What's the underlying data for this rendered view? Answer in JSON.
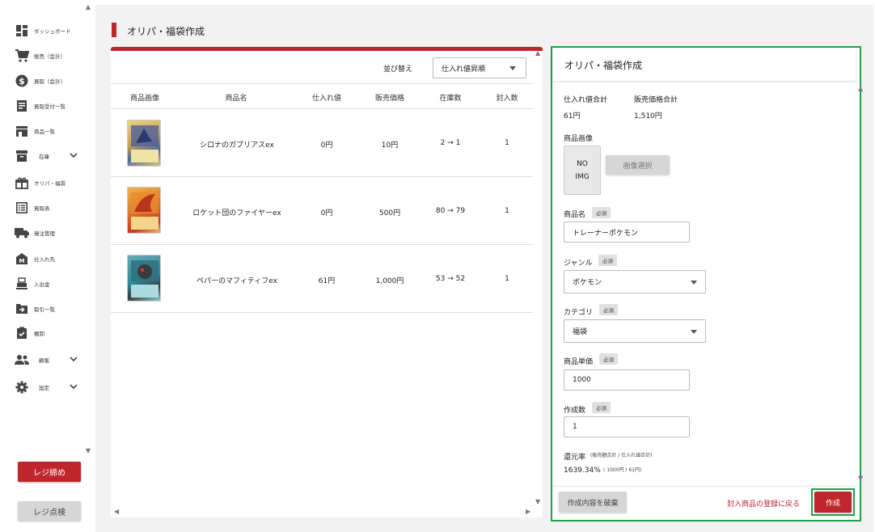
{
  "sidebar": {
    "items": [
      {
        "label": "ダッシュボード",
        "icon": "dashboard-icon"
      },
      {
        "label": "販売（会計）",
        "icon": "cart-icon"
      },
      {
        "label": "買取（会計）",
        "icon": "dollar-icon"
      },
      {
        "label": "買取受付一覧",
        "icon": "receipt-icon"
      },
      {
        "label": "商品一覧",
        "icon": "store-icon"
      },
      {
        "label": "在庫",
        "icon": "archive-icon"
      },
      {
        "label": "オリパ・福袋",
        "icon": "gift-icon"
      },
      {
        "label": "買取表",
        "icon": "list-icon"
      },
      {
        "label": "発注管理",
        "icon": "truck-icon"
      },
      {
        "label": "仕入れ先",
        "icon": "factory-icon"
      },
      {
        "label": "入出金",
        "icon": "register-icon"
      },
      {
        "label": "取引一覧",
        "icon": "arrow-box-icon"
      },
      {
        "label": "棚卸",
        "icon": "clipboard-check-icon"
      },
      {
        "label": "顧客",
        "icon": "people-icon"
      },
      {
        "label": "設定",
        "icon": "gear-icon"
      }
    ],
    "close_register_label": "レジ締め",
    "check_register_label": "レジ点検"
  },
  "page": {
    "title": "オリパ・福袋作成"
  },
  "list": {
    "sort_label": "並び替え",
    "sort_value": "仕入れ値昇順",
    "columns": [
      "商品画像",
      "商品名",
      "仕入れ値",
      "販売価格",
      "在庫数",
      "封入数"
    ],
    "rows": [
      {
        "name": "シロナのガブリアスex",
        "cost": "0円",
        "price": "10円",
        "stock": "2 → 1",
        "qty": "1",
        "card_color": "#c9a24a"
      },
      {
        "name": "ロケット団のファイヤーex",
        "cost": "0円",
        "price": "500円",
        "stock": "80 → 79",
        "qty": "1",
        "card_color": "#d9712a"
      },
      {
        "name": "ペパーのマフィティフex",
        "cost": "61円",
        "price": "1,000円",
        "stock": "53 → 52",
        "qty": "1",
        "card_color": "#2f8a9a"
      }
    ]
  },
  "form": {
    "title": "オリパ・福袋作成",
    "cost_total_label": "仕入れ値合計",
    "cost_total_value": "61円",
    "price_total_label": "販売価格合計",
    "price_total_value": "1,510円",
    "image_label": "商品画像",
    "noimg_line1": "NO",
    "noimg_line2": "IMG",
    "image_select_label": "画像選択",
    "name_label": "商品名",
    "required": "必須",
    "name_value": "トレーナーポケモン",
    "genre_label": "ジャンル",
    "genre_value": "ポケモン",
    "category_label": "カテゴリ",
    "category_value": "福袋",
    "unit_price_label": "商品単価",
    "unit_price_value": "1000",
    "count_label": "作成数",
    "count_value": "1",
    "return_rate_label": "還元率",
    "return_rate_note": "(販売額合計 / 仕入れ値合計)",
    "return_rate_value": "1639.34%",
    "return_rate_calc": "( 1000円 / 61円)",
    "discard_label": "作成内容を破棄",
    "back_label": "封入商品の登録に戻る",
    "create_label": "作成"
  },
  "colors": {
    "accent_red": "#c0272d",
    "highlight_green": "#1aa447"
  }
}
